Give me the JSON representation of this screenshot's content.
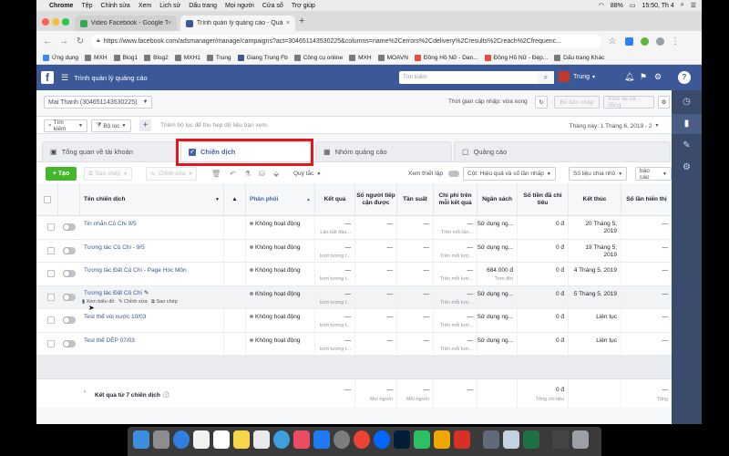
{
  "menubar": {
    "app": "Chrome",
    "items": [
      "Tệp",
      "Chỉnh sửa",
      "Xem",
      "Lịch sử",
      "Dấu trang",
      "Mọi người",
      "Cửa sổ",
      "Trợ giúp"
    ],
    "battery": "88%",
    "clock": "15:50, Th 4"
  },
  "browser": {
    "tabs": [
      {
        "label": "Video Facebook - Google Trang"
      },
      {
        "label": "Trình quản lý quảng cáo - Quả"
      }
    ],
    "new_tab": "+",
    "url": "https://www.facebook.com/adsmanager/manage/campaigns?act=304651143530225&columns=name%2Cerrors%2Cdelivery%2Cresults%2Creach%2Cfrequenc...",
    "bookmarks": [
      "Ứng dụng",
      "MXH",
      "Blog1",
      "Blog2",
      "MXH1",
      "Trung",
      "Giang Trung Fb",
      "Công cụ online",
      "MXH",
      "MOAVN",
      "Đồng Hồ Nữ - Dan...",
      "Đồng Hồ Nữ - Đẹp...",
      "Dấu trang Khác"
    ]
  },
  "fb": {
    "logo": "f",
    "title": "Trình quản lý quảng cáo",
    "search_placeholder": "Tìm kiếm",
    "user": "Trung"
  },
  "toolbar": {
    "account": "Mai Thanh (304651143530225)",
    "last_updated": "Thời gian cập nhập: vừa xong",
    "draft": "Bỏ bản nháp",
    "review": "Xem lại và đăng",
    "search": "Tìm kiếm",
    "filter": "Bộ lọc",
    "filter_hint": "Thêm bộ lọc để thu hẹp dữ liệu bạn xem.",
    "date_range": "Tháng này: 1 Tháng 6, 2019 - 2"
  },
  "level_tabs": [
    {
      "label": "Tổng quan về tài khoản"
    },
    {
      "label": "Chiến dịch"
    },
    {
      "label": "Nhóm quảng cáo"
    },
    {
      "label": "Quảng cáo"
    }
  ],
  "actions": {
    "create": "+ Tạo",
    "copy": "Sao chép",
    "edit": "Chỉnh sửa",
    "rules": "Quy tắc",
    "view_setup": "Xem thiết lập",
    "columns": "Cột: Hiệu quả và số lần nhấp",
    "breakdown": "Số liệu chia nhỏ",
    "reports": "báo cáo"
  },
  "columns": {
    "name": "Tên chiến dịch",
    "delivery": "Phân phối",
    "results": "Kết quả",
    "reach": "Số người tiếp cận được",
    "frequency": "Tần suất",
    "cost_per_result": "Chi phí trên mỗi kết quả",
    "budget": "Ngân sách",
    "spent": "Số tiền đã chi tiêu",
    "ends": "Kết thúc",
    "impressions": "Số lần hiển thị"
  },
  "rows": [
    {
      "name": "Tin nhắn Củ Chi 9/5",
      "delivery": "Không hoạt động",
      "results": "—",
      "results_sub": "Lần bắt đầu...",
      "reach": "—",
      "freq": "—",
      "cpr": "—",
      "cpr_sub": "Trên mỗi lần...",
      "budget": "Sử dụng ng...",
      "spent": "0 đ",
      "ends": "20 Tháng 5,",
      "ends2": "2019",
      "imp": "—"
    },
    {
      "name": "Tương tác Củ Chi - 9/5",
      "delivery": "Không hoạt động",
      "results": "—",
      "results_sub": "lượt tương t...",
      "reach": "—",
      "freq": "—",
      "cpr": "—",
      "cpr_sub": "Trên mỗi lượ...",
      "budget": "Sử dụng ng...",
      "spent": "0 đ",
      "ends": "19 Tháng 5,",
      "ends2": "2019",
      "imp": "—"
    },
    {
      "name": "Tương tác Đất Củ Chi - Page Hóc Môn",
      "delivery": "Không hoạt động",
      "results": "—",
      "results_sub": "lượt tương t...",
      "reach": "—",
      "freq": "—",
      "cpr": "—",
      "cpr_sub": "Trên mỗi lượ...",
      "budget": "684.000 đ",
      "budget_sub": "Trọn đời",
      "spent": "0 đ",
      "ends": "4 Tháng 5, 2019",
      "ends2": "",
      "imp": "—"
    },
    {
      "name": "Tương tác Đất Củ Chi",
      "delivery": "Không hoạt động",
      "results": "—",
      "results_sub": "lượt tương t...",
      "reach": "—",
      "freq": "—",
      "cpr": "—",
      "cpr_sub": "Trên mỗi lượ...",
      "budget": "Sử dụng ng...",
      "spent": "0 đ",
      "ends": "5 Tháng 5, 2019",
      "ends2": "",
      "imp": "—",
      "hover": {
        "view": "Xem biểu đồ",
        "edit": "Chỉnh sửa",
        "copy": "Sao chép"
      }
    },
    {
      "name": "Test thể vòi nước 10/03",
      "delivery": "Không hoạt động",
      "results": "—",
      "results_sub": "lượt tương t...",
      "reach": "—",
      "freq": "—",
      "cpr": "—",
      "cpr_sub": "Trên mỗi lượ...",
      "budget": "Sử dụng ng...",
      "spent": "0 đ",
      "ends": "Liên tục",
      "ends2": "",
      "imp": "—"
    },
    {
      "name": "Test thể DÉP 07/03",
      "delivery": "Không hoạt động",
      "results": "—",
      "results_sub": "lượt tương t...",
      "reach": "—",
      "freq": "—",
      "cpr": "—",
      "cpr_sub": "Trên mỗi lượ...",
      "budget": "Sử dụng ng...",
      "spent": "0 đ",
      "ends": "Liên tục",
      "ends2": "",
      "imp": "—"
    }
  ],
  "totals": {
    "label": "Kết quả từ 7 chiến dịch",
    "results": "—",
    "reach": "—",
    "reach_sub": "Mọi người",
    "freq": "—",
    "freq_sub": "Mỗi người",
    "cpr": "—",
    "spent": "0 đ",
    "spent_sub": "Tổng chi tiêu",
    "imp": "—",
    "imp_sub": "Tổng"
  }
}
